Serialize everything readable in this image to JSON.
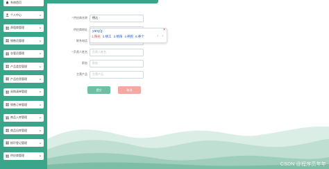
{
  "sidebar": {
    "items": [
      {
        "label": "系统首页",
        "icon": "home-icon",
        "has_chevron": false
      },
      {
        "label": "个人中心",
        "icon": "user-icon",
        "has_chevron": true
      },
      {
        "label": "承租商管理",
        "icon": "grid-icon",
        "has_chevron": true
      },
      {
        "label": "销售员管理",
        "icon": "grid-icon",
        "has_chevron": true
      },
      {
        "label": "仓管员管理",
        "icon": "grid-icon",
        "has_chevron": true
      },
      {
        "label": "产品类型管理",
        "icon": "grid-icon",
        "has_chevron": true
      },
      {
        "label": "产品信息管理",
        "icon": "grid-icon",
        "has_chevron": true
      },
      {
        "label": "采购清单管理",
        "icon": "grid-icon",
        "has_chevron": true
      },
      {
        "label": "销售订单管理",
        "icon": "grid-icon",
        "has_chevron": true
      },
      {
        "label": "商品入库管理",
        "icon": "grid-icon",
        "has_chevron": true
      },
      {
        "label": "商品出库管理",
        "icon": "grid-icon",
        "has_chevron": true
      },
      {
        "label": "损坏登记管理",
        "icon": "grid-icon",
        "has_chevron": true
      },
      {
        "label": "供应商管理",
        "icon": "grid-icon",
        "has_chevron": true
      }
    ]
  },
  "form": {
    "fields": [
      {
        "label": "供应商名称",
        "required": true,
        "value": "德达",
        "placeholder": ""
      },
      {
        "label": "供应商地址",
        "required": false,
        "value": "yangg",
        "placeholder": ""
      },
      {
        "label": "联系电话",
        "required": false,
        "value": "",
        "placeholder": ""
      },
      {
        "label": "负责人姓名",
        "required": true,
        "value": "",
        "placeholder": "负责人姓名"
      },
      {
        "label": "职务",
        "required": false,
        "value": "",
        "placeholder": "职务"
      },
      {
        "label": "主营产品",
        "required": false,
        "value": "",
        "placeholder": "主营产品"
      }
    ],
    "submit_label": "提交",
    "cancel_label": "取消"
  },
  "ime": {
    "composition": "yang'g",
    "candidates": [
      {
        "num": "1",
        "text": "阳光"
      },
      {
        "num": "2",
        "text": "杨工"
      },
      {
        "num": "3",
        "text": "杨阳"
      },
      {
        "num": "4",
        "text": "养狗"
      },
      {
        "num": "5",
        "text": "养个"
      }
    ],
    "arrow_prev": "‹",
    "arrow_next": "›"
  },
  "watermark": "CSDN @程序员年年",
  "colors": {
    "primary_green": "#3aa588",
    "submit_button": "#6fbfa5",
    "cancel_button": "#f3a8a4",
    "required_star": "#e0403c"
  }
}
